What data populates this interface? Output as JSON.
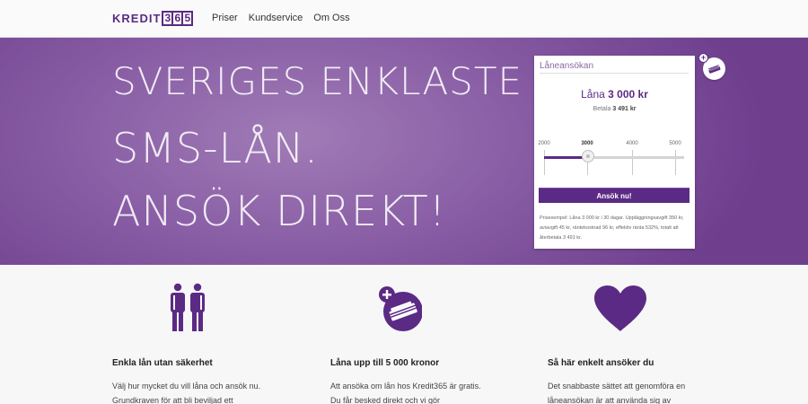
{
  "brand": {
    "text": "KREDIT",
    "digits": [
      "3",
      "6",
      "5"
    ]
  },
  "nav": {
    "items": [
      "Priser",
      "Kundservice",
      "Om Oss"
    ]
  },
  "hero": {
    "lines": [
      "SVERIGES ENKLASTE",
      "SMS-LÅN.",
      "ANSÖK DIREKT!"
    ]
  },
  "widget": {
    "title": "Låneansökan",
    "amount_label": "Låna",
    "amount_value": "3 000 kr",
    "repay_label": "Betala",
    "repay_value": "3 491 kr",
    "slider": {
      "ticks": [
        "2000",
        "3000",
        "4000",
        "5000"
      ],
      "min": 2000,
      "max": 5000,
      "value": 3000
    },
    "apply_label": "Ansök nu!",
    "price_example": "Prisexempel: Låna 3 000 kr i 30 dagar. Uppläggningsavgift 350 kr, aviavgift 45 kr, räntekostnad 96 kr, effektiv ränta 532%, totalt att återbetala 3 491 kr."
  },
  "features": [
    {
      "icon": "people-icon",
      "title": "Enkla lån utan säkerhet",
      "text": "Välj hur mycket du vill låna och ansök nu. Grundkraven för att bli beviljad ett"
    },
    {
      "icon": "money-add-icon",
      "title": "Låna upp till 5 000 kronor",
      "text": "Att ansöka om lån hos Kredit365 är gratis. Du får besked direkt och vi gör"
    },
    {
      "icon": "heart-icon",
      "title": "Så här enkelt ansöker du",
      "text": "Det snabbaste sättet att genomföra en låneansökan är att använda sig av"
    }
  ],
  "colors": {
    "brand": "#5b2a84",
    "hero_gradient": [
      "#a07cb6",
      "#6f3f8e"
    ]
  }
}
